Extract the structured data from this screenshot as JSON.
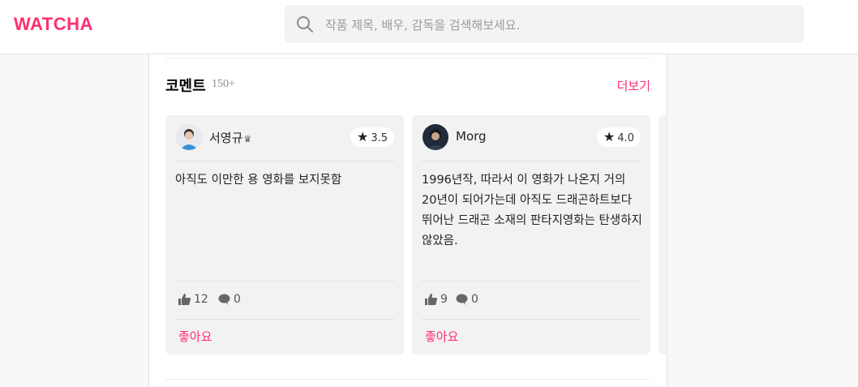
{
  "header": {
    "logo": "WATCHA",
    "search_placeholder": "작품 제목, 배우, 감독을 검색해보세요."
  },
  "comments": {
    "title": "코멘트",
    "count": "150+",
    "more_label": "더보기",
    "items": [
      {
        "user": "서영규",
        "badge": "♛",
        "rating": "3.5",
        "text": "아직도 이만한 용 영화를 보지못함",
        "likes": "12",
        "replies": "0",
        "like_label": "좋아요"
      },
      {
        "user": "Morg",
        "rating": "4.0",
        "text": "1996년작, 따라서 이 영화가 나온지 거의 20년이 되어가는데 아직도 드래곤하트보다 뛰어난 드래곤 소재의 판타지영화는 탄생하지 않았음.",
        "likes": "9",
        "replies": "0",
        "like_label": "좋아요"
      }
    ]
  },
  "colors": {
    "brand": "#ff2f6e"
  }
}
